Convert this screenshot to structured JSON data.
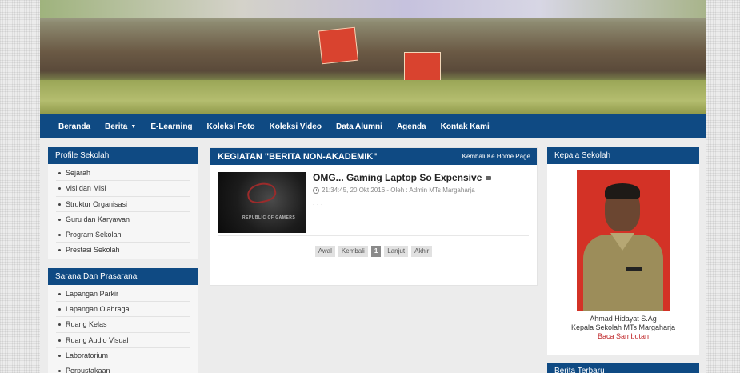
{
  "nav": {
    "items": [
      {
        "label": "Beranda",
        "dropdown": false
      },
      {
        "label": "Berita",
        "dropdown": true
      },
      {
        "label": "E-Learning",
        "dropdown": false
      },
      {
        "label": "Koleksi Foto",
        "dropdown": false
      },
      {
        "label": "Koleksi Video",
        "dropdown": false
      },
      {
        "label": "Data Alumni",
        "dropdown": false
      },
      {
        "label": "Agenda",
        "dropdown": false
      },
      {
        "label": "Kontak Kami",
        "dropdown": false
      }
    ],
    "caret": "▼"
  },
  "left": {
    "profile": {
      "title": "Profile Sekolah",
      "items": [
        "Sejarah",
        "Visi dan Misi",
        "Struktur Organisasi",
        "Guru dan Karyawan",
        "Program Sekolah",
        "Prestasi Sekolah"
      ]
    },
    "sarana": {
      "title": "Sarana Dan Prasarana",
      "items": [
        "Lapangan Parkir",
        "Lapangan Olahraga",
        "Ruang Kelas",
        "Ruang Audio Visual",
        "Laboratorium",
        "Perpustakaan"
      ]
    }
  },
  "main": {
    "title": "KEGIATAN \"BERITA NON-AKADEMIK\"",
    "back_link": "Kembali Ke Home Page",
    "post": {
      "title": "OMG... Gaming Laptop So Expensive",
      "meta": "21:34:45, 20 Okt 2016 - Oleh : Admin MTs Margaharja",
      "excerpt": ". . .",
      "thumb_text": "REPUBLIC OF GAMERS"
    },
    "pager": {
      "first": "Awal",
      "prev": "Kembali",
      "current": "1",
      "next": "Lanjut",
      "last": "Akhir"
    }
  },
  "right": {
    "kepsek": {
      "title": "Kepala Sekolah",
      "name": "Ahmad Hidayat S.Ag",
      "role": "Kepala Sekolah MTs Margaharja",
      "link": "Baca Sambutan"
    },
    "berita": {
      "title": "Berita Terbaru"
    }
  },
  "colors": {
    "accent": "#0f4a83",
    "link_red": "#c0282b"
  }
}
